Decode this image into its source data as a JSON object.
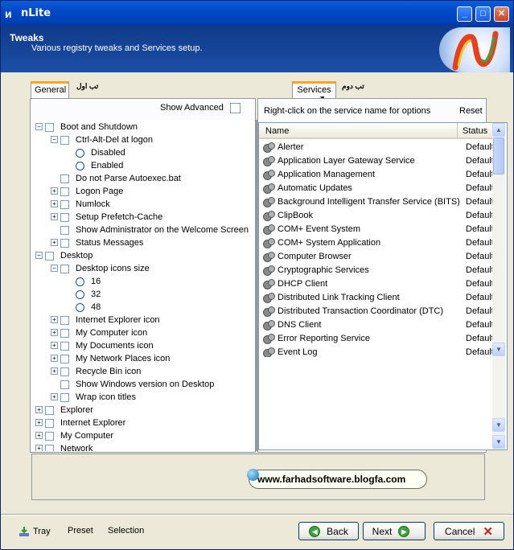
{
  "window": {
    "title": "nLite",
    "app_icon": "nlite-logo-icon"
  },
  "header": {
    "title": "Tweaks",
    "subtitle": "Various registry tweaks and Services setup."
  },
  "left_tab": {
    "label": "General",
    "caption": "تب اول"
  },
  "right_tab": {
    "label": "Services",
    "caption": "تب دوم"
  },
  "show_advanced_label": "Show Advanced",
  "tree": [
    {
      "label": "Boot and Shutdown",
      "level": 0,
      "expanded": true,
      "control": "checkbox"
    },
    {
      "label": "Ctrl-Alt-Del at logon",
      "level": 1,
      "expanded": true,
      "control": "checkbox"
    },
    {
      "label": "Disabled",
      "level": 2,
      "control": "radio"
    },
    {
      "label": "Enabled",
      "level": 2,
      "control": "radio"
    },
    {
      "label": "Do not Parse Autoexec.bat",
      "level": 1,
      "control": "checkbox"
    },
    {
      "label": "Logon Page",
      "level": 1,
      "expanded": false,
      "control": "checkbox"
    },
    {
      "label": "Numlock",
      "level": 1,
      "expanded": false,
      "control": "checkbox"
    },
    {
      "label": "Setup Prefetch-Cache",
      "level": 1,
      "expanded": false,
      "control": "checkbox"
    },
    {
      "label": "Show Administrator on the Welcome Screen",
      "level": 1,
      "control": "checkbox"
    },
    {
      "label": "Status Messages",
      "level": 1,
      "expanded": false,
      "control": "checkbox"
    },
    {
      "label": "Desktop",
      "level": 0,
      "expanded": true,
      "control": "checkbox"
    },
    {
      "label": "Desktop icons size",
      "level": 1,
      "expanded": true,
      "control": "checkbox"
    },
    {
      "label": "16",
      "level": 2,
      "control": "radio"
    },
    {
      "label": "32",
      "level": 2,
      "control": "radio"
    },
    {
      "label": "48",
      "level": 2,
      "control": "radio"
    },
    {
      "label": "Internet Explorer icon",
      "level": 1,
      "expanded": false,
      "control": "checkbox"
    },
    {
      "label": "My Computer icon",
      "level": 1,
      "expanded": false,
      "control": "checkbox"
    },
    {
      "label": "My Documents icon",
      "level": 1,
      "expanded": false,
      "control": "checkbox"
    },
    {
      "label": "My Network Places icon",
      "level": 1,
      "expanded": false,
      "control": "checkbox"
    },
    {
      "label": "Recycle Bin icon",
      "level": 1,
      "expanded": false,
      "control": "checkbox"
    },
    {
      "label": "Show Windows version on Desktop",
      "level": 1,
      "control": "checkbox"
    },
    {
      "label": "Wrap icon titles",
      "level": 1,
      "expanded": false,
      "control": "checkbox"
    },
    {
      "label": "Explorer",
      "level": 0,
      "expanded": false,
      "control": "checkbox"
    },
    {
      "label": "Internet Explorer",
      "level": 0,
      "expanded": false,
      "control": "checkbox"
    },
    {
      "label": "My Computer",
      "level": 0,
      "expanded": false,
      "control": "checkbox"
    },
    {
      "label": "Network",
      "level": 0,
      "expanded": false,
      "control": "checkbox"
    }
  ],
  "services_hint": "Right-click on the service name for options",
  "reset_label": "Reset",
  "columns": {
    "name": "Name",
    "status": "Status"
  },
  "services": [
    {
      "name": "Alerter",
      "status": "Default"
    },
    {
      "name": "Application Layer Gateway Service",
      "status": "Default"
    },
    {
      "name": "Application Management",
      "status": "Default"
    },
    {
      "name": "Automatic Updates",
      "status": "Default"
    },
    {
      "name": "Background Intelligent Transfer Service (BITS)",
      "status": "Default"
    },
    {
      "name": "ClipBook",
      "status": "Default"
    },
    {
      "name": "COM+ Event System",
      "status": "Default"
    },
    {
      "name": "COM+ System Application",
      "status": "Default"
    },
    {
      "name": "Computer Browser",
      "status": "Default"
    },
    {
      "name": "Cryptographic Services",
      "status": "Default"
    },
    {
      "name": "DHCP Client",
      "status": "Default"
    },
    {
      "name": "Distributed Link Tracking Client",
      "status": "Default"
    },
    {
      "name": "Distributed Transaction Coordinator (DTC)",
      "status": "Default"
    },
    {
      "name": "DNS Client",
      "status": "Default"
    },
    {
      "name": "Error Reporting Service",
      "status": "Default"
    },
    {
      "name": "Event Log",
      "status": "Default"
    }
  ],
  "watermark": "www.farhadsoftware.blogfa.com",
  "footer": {
    "tray": "Tray",
    "preset": "Preset",
    "selection": "Selection"
  },
  "buttons": {
    "back": "Back",
    "next": "Next",
    "cancel": "Cancel"
  },
  "colors": {
    "titlebar": "#0049c8",
    "header": "#1b4fa6",
    "tab_accent": "#f5a623",
    "button_green": "#3aa33a"
  }
}
